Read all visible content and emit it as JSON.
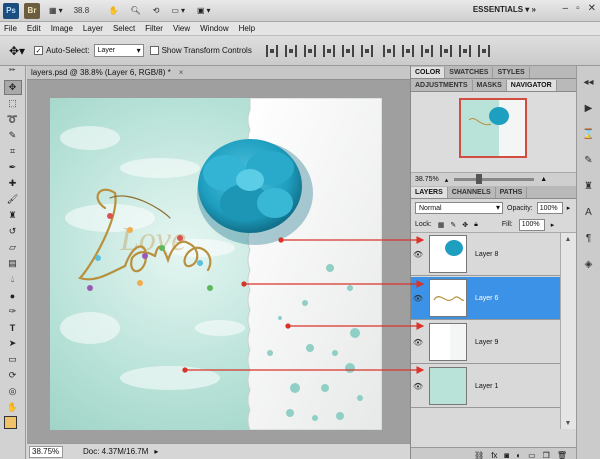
{
  "appbar": {
    "ps_logo": "Ps",
    "br_logo": "Br",
    "zoom_value": "38.8",
    "workspace": "ESSENTIALS"
  },
  "menu": {
    "items": [
      "File",
      "Edit",
      "Image",
      "Layer",
      "Select",
      "Filter",
      "View",
      "Window",
      "Help"
    ]
  },
  "options": {
    "auto_select_label": "Auto-Select:",
    "auto_select_value": "Layer",
    "show_transform_label": "Show Transform Controls"
  },
  "document": {
    "tab_title": "layers.psd @ 38.8% (Layer 6, RGB/8) *",
    "close_glyph": "×",
    "artwork_word": "Love",
    "status_zoom": "38.75%",
    "status_doc": "Doc: 4.37M/16.7M"
  },
  "panels": {
    "top_tabs": [
      "COLOR",
      "SWATCHES",
      "STYLES"
    ],
    "nav_tabs": [
      "ADJUSTMENTS",
      "MASKS",
      "NAVIGATOR"
    ],
    "nav_zoom": "38.75%",
    "layer_tabs": [
      "LAYERS",
      "CHANNELS",
      "PATHS"
    ],
    "blend_mode": "Normal",
    "opacity_label": "Opacity:",
    "opacity_value": "100%",
    "lock_label": "Lock:",
    "fill_label": "Fill:",
    "fill_value": "100%",
    "layers": [
      {
        "name": "Layer 8",
        "selected": false
      },
      {
        "name": "Layer 6",
        "selected": true
      },
      {
        "name": "Layer 9",
        "selected": false
      },
      {
        "name": "Layer 1",
        "selected": false
      }
    ]
  },
  "colors": {
    "selection": "#3c92e6",
    "arrow": "#d9332b",
    "foreground_swatch": "#f0c36b",
    "flower": "#1f9fc0"
  }
}
